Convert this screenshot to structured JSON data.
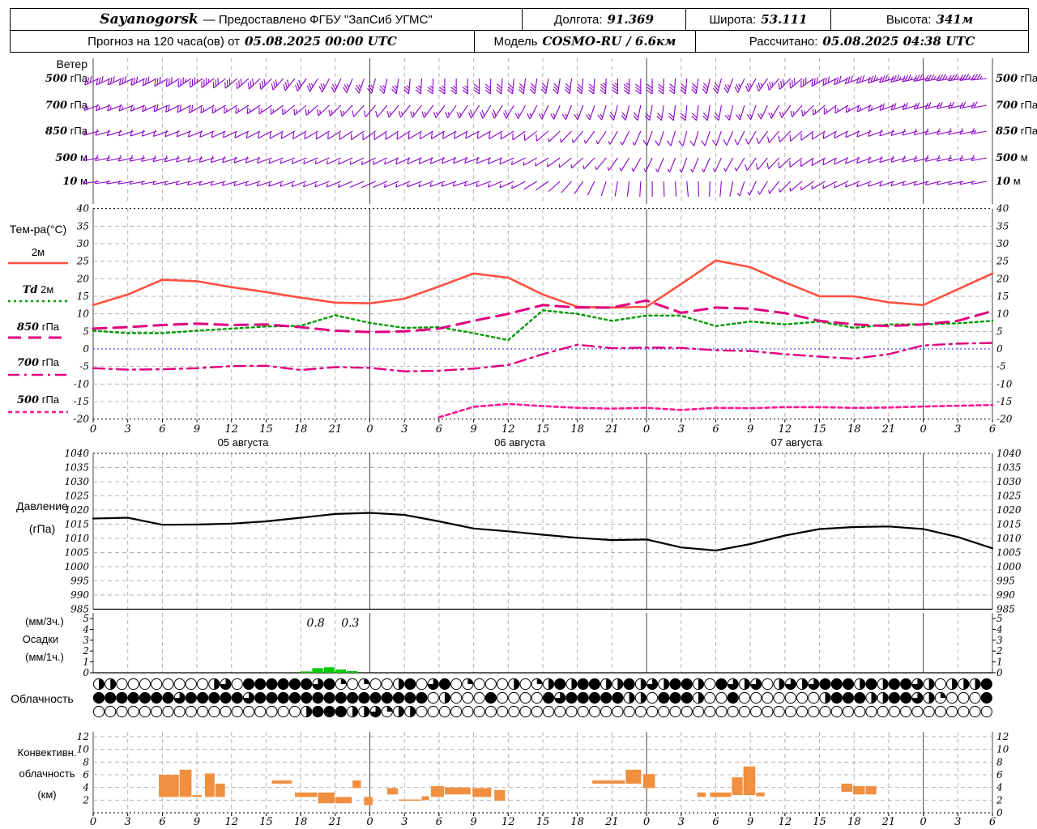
{
  "header": {
    "station": "Sayanogorsk",
    "provider": "— Предоставлено ФГБУ \"ЗапСиб УГМС\"",
    "lon_label": "Долгота:",
    "lon_value": "91.369",
    "lat_label": "Широта:",
    "lat_value": "53.111",
    "alt_label": "Высота:",
    "alt_value": "341м",
    "forecast_label": "Прогноз на 120 часа(ов) от",
    "forecast_time": "05.08.2025 00:00 UTC",
    "model_label": "Модель",
    "model_name": "COSMO-RU",
    "model_res": "/ 6.6км",
    "calc_label": "Рассчитано:",
    "calc_time": "05.08.2025 04:38 UTC"
  },
  "chart_data": {
    "type": "meteogram",
    "hours_span": 78,
    "x_tick_step": 3,
    "date_labels": [
      {
        "text": "05 августа",
        "h": 13
      },
      {
        "text": "06 августа",
        "h": 37
      },
      {
        "text": "07 августа",
        "h": 61
      }
    ],
    "colors": {
      "temp2m": "#ff5040",
      "td2m": "#009900",
      "t850": "#e0007f",
      "t700": "#e0007f",
      "t500": "#ff1493",
      "zero_line": "#4444ff",
      "wind_barb": "#8a00c8",
      "pressure": "#000000",
      "precip_bar": "#00cc00",
      "conv_bar": "#ef8f3f",
      "grid": "#b3b3b3",
      "day_line": "#444444"
    },
    "wind": {
      "title": "Ветер",
      "levels": [
        {
          "label": "500 гПа",
          "dirs": [
            245,
            245,
            240,
            235,
            230,
            225,
            215,
            205,
            195,
            185,
            180,
            180,
            185,
            190,
            185,
            180,
            180,
            185,
            195,
            210,
            225,
            240,
            250,
            255,
            260,
            262,
            265
          ],
          "speeds": [
            15,
            16,
            17,
            18,
            17,
            16,
            15,
            14,
            13,
            13,
            14,
            15,
            15,
            16,
            17,
            18,
            17,
            16,
            15,
            14,
            15,
            16,
            17,
            18,
            18,
            19,
            20
          ]
        },
        {
          "label": "700 гПа",
          "dirs": [
            250,
            248,
            245,
            240,
            238,
            235,
            230,
            225,
            220,
            218,
            215,
            212,
            210,
            205,
            200,
            195,
            190,
            185,
            190,
            200,
            215,
            230,
            242,
            250,
            255,
            258,
            260
          ],
          "speeds": [
            9,
            9,
            10,
            10,
            9,
            9,
            8,
            8,
            7,
            8,
            9,
            10,
            10,
            9,
            8,
            10,
            12,
            12,
            10,
            8,
            8,
            9,
            9,
            10,
            10,
            11,
            12
          ]
        },
        {
          "label": "850 гПа",
          "dirs": [
            255,
            252,
            250,
            248,
            245,
            242,
            240,
            238,
            235,
            238,
            240,
            242,
            238,
            230,
            220,
            210,
            200,
            195,
            200,
            210,
            225,
            238,
            246,
            252,
            256,
            258,
            260
          ],
          "speeds": [
            6,
            7,
            7,
            7,
            6,
            6,
            5,
            5,
            5,
            6,
            6,
            7,
            6,
            5,
            4,
            4,
            5,
            6,
            6,
            6,
            6,
            7,
            7,
            7,
            6,
            7,
            8
          ]
        },
        {
          "label": "500 м",
          "dirs": [
            260,
            258,
            256,
            254,
            252,
            250,
            248,
            246,
            244,
            246,
            248,
            250,
            246,
            238,
            228,
            215,
            205,
            200,
            205,
            215,
            228,
            240,
            248,
            253,
            256,
            258,
            260
          ],
          "speeds": [
            5,
            5,
            6,
            6,
            5,
            5,
            4,
            4,
            4,
            5,
            5,
            5,
            5,
            4,
            3,
            3,
            3,
            4,
            4,
            5,
            5,
            5,
            6,
            6,
            5,
            5,
            6
          ]
        },
        {
          "label": "10 м",
          "dirs": [
            262,
            260,
            258,
            256,
            254,
            252,
            250,
            248,
            246,
            248,
            250,
            252,
            246,
            235,
            215,
            190,
            180,
            175,
            185,
            205,
            225,
            240,
            248,
            252,
            255,
            258,
            260
          ],
          "speeds": [
            3,
            4,
            4,
            4,
            3,
            3,
            3,
            3,
            2,
            3,
            4,
            4,
            3,
            2,
            2,
            2,
            2,
            2,
            2,
            3,
            3,
            4,
            4,
            4,
            3,
            4,
            4
          ]
        }
      ]
    },
    "temp": {
      "title": "Тем-ра(°C)",
      "ylim": [
        -20,
        40
      ],
      "ytick_step": 5,
      "series": [
        {
          "id": "t2m",
          "legend": "2м",
          "color": "#ff5040",
          "dash": "",
          "width": 2.6,
          "values": [
            12.5,
            15.5,
            19.7,
            19.3,
            17.6,
            16.2,
            14.6,
            13.2,
            13.0,
            14.3,
            17.8,
            21.5,
            20.3,
            15.5,
            12.0,
            11.8,
            12.0,
            18.5,
            25.2,
            23.3,
            19.0,
            15.0,
            15.0,
            13.3,
            12.5,
            17.0,
            21.5
          ]
        },
        {
          "id": "td2m",
          "legend": "Td 2м",
          "color": "#009900",
          "dash": "3 4",
          "width": 2.4,
          "values": [
            5.2,
            4.5,
            4.5,
            5.2,
            5.8,
            6.4,
            6.6,
            9.6,
            7.4,
            6.0,
            6.2,
            4.5,
            2.5,
            11.0,
            10.0,
            8.0,
            9.5,
            9.5,
            6.5,
            7.8,
            7.0,
            7.8,
            6.0,
            7.0,
            7.0,
            7.3,
            8.0
          ]
        },
        {
          "id": "t850",
          "legend": "850 гПа",
          "color": "#e0007f",
          "dash": "16 9",
          "width": 3,
          "values": [
            5.8,
            6.2,
            6.8,
            7.2,
            6.8,
            7.0,
            6.2,
            5.2,
            4.8,
            5.0,
            5.8,
            8.0,
            10.0,
            12.5,
            11.8,
            11.8,
            13.8,
            10.3,
            11.8,
            11.5,
            10.2,
            8.0,
            7.0,
            6.5,
            7.0,
            8.0,
            10.8
          ]
        },
        {
          "id": "t700",
          "legend": "700 гПа",
          "color": "#e0007f",
          "dash": "14 6 3 6",
          "width": 2.4,
          "values": [
            -5.5,
            -5.9,
            -5.8,
            -5.5,
            -4.9,
            -4.8,
            -6.0,
            -5.2,
            -5.4,
            -6.4,
            -6.2,
            -5.6,
            -4.6,
            -1.5,
            1.2,
            0.2,
            0.4,
            0.3,
            -0.4,
            -0.6,
            -1.5,
            -2.2,
            -2.8,
            -1.5,
            1.0,
            1.5,
            1.7
          ]
        },
        {
          "id": "t500",
          "legend": "500 гПа",
          "color": "#ff1493",
          "dash": "5 4",
          "width": 2.6,
          "values": [
            null,
            null,
            null,
            null,
            null,
            null,
            null,
            null,
            null,
            null,
            -19.5,
            -16.5,
            -15.7,
            -16.3,
            -16.8,
            -17.0,
            -16.8,
            -17.4,
            -16.8,
            -16.9,
            -16.6,
            -16.6,
            -16.8,
            -16.7,
            -16.4,
            -16.2,
            -16.0
          ]
        }
      ]
    },
    "pressure": {
      "title1": "Давление",
      "title2": "(гПа)",
      "ylim": [
        985,
        1040
      ],
      "ytick_step": 5,
      "values": [
        1017,
        1017.3,
        1014.8,
        1014.9,
        1015.2,
        1016,
        1017.3,
        1018.6,
        1019,
        1018.3,
        1016,
        1013.5,
        1012.5,
        1011.3,
        1010.2,
        1009.4,
        1009.6,
        1006.8,
        1005.7,
        1008,
        1011,
        1013.3,
        1014,
        1014.2,
        1013.3,
        1010.5,
        1006.5
      ]
    },
    "precip": {
      "title1": "(мм/3ч.)",
      "title2": "Осадки",
      "title3": "(мм/1ч.)",
      "ylim": [
        0,
        5
      ],
      "ytick_step": 1,
      "bars": [
        [
          18,
          0.12
        ],
        [
          19,
          0.42
        ],
        [
          20,
          0.5
        ],
        [
          21,
          0.3
        ],
        [
          22,
          0.15
        ]
      ],
      "annotations": [
        {
          "h": 19.3,
          "text": "0.8"
        },
        {
          "h": 22.3,
          "text": "0.3"
        }
      ]
    },
    "clouds": {
      "title": "Облачность",
      "rows": [
        [
          2,
          2,
          0,
          0,
          0,
          0,
          0,
          0,
          0,
          0,
          2,
          3,
          0,
          4,
          4,
          4,
          4,
          4,
          4,
          3,
          4,
          1,
          0,
          1,
          0,
          0,
          2,
          4,
          0,
          3,
          4,
          0,
          1,
          0,
          0,
          0,
          2,
          0,
          1,
          2,
          4,
          2,
          4,
          4,
          2,
          2,
          4,
          2,
          3,
          2,
          4,
          4,
          2,
          0,
          4,
          3,
          2,
          3,
          0,
          2,
          3,
          2,
          3,
          4,
          4,
          4,
          2,
          4,
          2,
          4,
          4,
          3,
          2,
          0,
          2,
          2,
          2,
          4
        ],
        [
          4,
          4,
          4,
          4,
          4,
          4,
          4,
          3,
          4,
          4,
          4,
          4,
          4,
          3,
          4,
          4,
          4,
          4,
          4,
          4,
          4,
          4,
          4,
          4,
          4,
          4,
          4,
          4,
          4,
          0,
          2,
          0,
          0,
          0,
          4,
          0,
          0,
          0,
          0,
          4,
          3,
          4,
          4,
          4,
          4,
          4,
          2,
          2,
          0,
          4,
          4,
          4,
          2,
          0,
          0,
          4,
          0,
          0,
          0,
          0,
          0,
          0,
          0,
          2,
          4,
          4,
          4,
          2,
          2,
          4,
          4,
          3,
          2,
          1,
          0,
          0,
          0,
          4
        ],
        [
          0,
          0,
          0,
          0,
          0,
          0,
          0,
          0,
          0,
          0,
          0,
          0,
          0,
          0,
          0,
          0,
          0,
          0,
          2,
          4,
          4,
          4,
          2,
          2,
          3,
          1,
          2,
          2,
          0,
          0,
          0,
          0,
          0,
          0,
          0,
          0,
          0,
          0,
          0,
          0,
          0,
          0,
          0,
          0,
          0,
          0,
          0,
          0,
          0,
          0,
          0,
          0,
          0,
          0,
          0,
          0,
          0,
          0,
          0,
          0,
          0,
          0,
          0,
          0,
          0,
          0,
          0,
          0,
          0,
          0,
          0,
          0,
          0,
          0,
          0,
          0,
          0,
          0
        ]
      ]
    },
    "convective": {
      "title1": "Конвективн.",
      "title2": "облачность",
      "title3": "(км)",
      "ylim": [
        0,
        12
      ],
      "ytick_step": 2,
      "bars": [
        [
          5.7,
          7.5,
          2.5,
          6.0
        ],
        [
          7.5,
          8.6,
          2.5,
          6.8
        ],
        [
          8.6,
          9.5,
          2.5,
          2.8
        ],
        [
          9.7,
          10.6,
          2.5,
          6.2
        ],
        [
          10.6,
          11.5,
          2.5,
          4.6
        ],
        [
          15.5,
          17.3,
          4.6,
          5.1
        ],
        [
          17.5,
          19.5,
          2.5,
          3.2
        ],
        [
          19.5,
          21,
          1.5,
          3.2
        ],
        [
          21,
          22.5,
          1.5,
          2.5
        ],
        [
          22.5,
          23.3,
          3.9,
          5.1
        ],
        [
          23.5,
          24.3,
          1.2,
          2.5
        ],
        [
          25.5,
          26.5,
          2.9,
          3.9
        ],
        [
          26.5,
          28.5,
          1.9,
          2.1
        ],
        [
          28.5,
          29.2,
          2.0,
          2.6
        ],
        [
          29.3,
          30.5,
          2.5,
          4.2
        ],
        [
          30.5,
          32.8,
          2.9,
          4.0
        ],
        [
          32.9,
          34.6,
          2.5,
          3.9
        ],
        [
          34.8,
          35.8,
          1.9,
          3.6
        ],
        [
          43.3,
          46.2,
          4.6,
          5.1
        ],
        [
          46.2,
          47.6,
          4.6,
          6.8
        ],
        [
          47.7,
          48.8,
          3.9,
          6.1
        ],
        [
          52.4,
          53.2,
          2.5,
          3.2
        ],
        [
          53.5,
          55.4,
          2.5,
          3.2
        ],
        [
          55.4,
          56.4,
          2.8,
          5.6
        ],
        [
          56.4,
          57.5,
          2.8,
          7.3
        ],
        [
          57.5,
          58.3,
          2.6,
          3.2
        ],
        [
          64.9,
          65.9,
          3.3,
          4.6
        ],
        [
          65.9,
          67.0,
          2.9,
          4.2
        ],
        [
          67.0,
          68.0,
          2.9,
          4.2
        ]
      ]
    }
  }
}
